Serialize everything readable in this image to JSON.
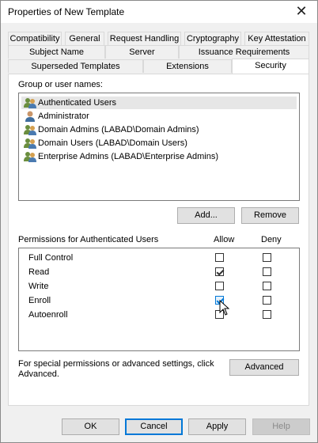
{
  "window": {
    "title": "Properties of New Template",
    "close_glyph": "✕"
  },
  "tabs_row1": [
    "Compatibility",
    "General",
    "Request Handling",
    "Cryptography",
    "Key Attestation"
  ],
  "tabs_row2": [
    "Subject Name",
    "Server",
    "Issuance Requirements"
  ],
  "tabs_row3": [
    "Superseded Templates",
    "Extensions",
    "Security"
  ],
  "active_tab": "Security",
  "group_label": "Group or user names:",
  "users": [
    {
      "name": "Authenticated Users",
      "icon": "group-users-icon",
      "selected": true
    },
    {
      "name": "Administrator",
      "icon": "single-user-icon",
      "selected": false
    },
    {
      "name": "Domain Admins (LABAD\\Domain Admins)",
      "icon": "group-users-icon",
      "selected": false
    },
    {
      "name": "Domain Users (LABAD\\Domain Users)",
      "icon": "group-users-icon",
      "selected": false
    },
    {
      "name": "Enterprise Admins (LABAD\\Enterprise Admins)",
      "icon": "group-users-icon",
      "selected": false
    }
  ],
  "add_label": "Add...",
  "remove_label": "Remove",
  "permissions_label": "Permissions for Authenticated Users",
  "allow_header": "Allow",
  "deny_header": "Deny",
  "permissions": [
    {
      "name": "Full Control",
      "allow": false,
      "deny": false
    },
    {
      "name": "Read",
      "allow": true,
      "deny": false
    },
    {
      "name": "Write",
      "allow": false,
      "deny": false
    },
    {
      "name": "Enroll",
      "allow": true,
      "deny": false
    },
    {
      "name": "Autoenroll",
      "allow": false,
      "deny": false
    }
  ],
  "special_text": "For special permissions or advanced settings, click Advanced.",
  "advanced_label": "Advanced",
  "buttons": {
    "ok": "OK",
    "cancel": "Cancel",
    "apply": "Apply",
    "help": "Help"
  },
  "colors": {
    "accent": "#0078d7",
    "selection": "#e6e6e6"
  }
}
